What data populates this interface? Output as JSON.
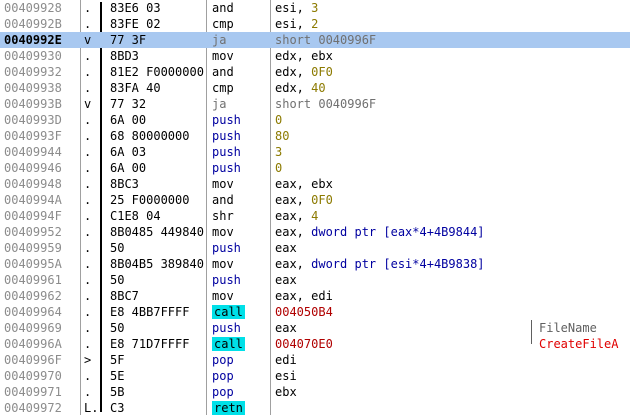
{
  "rows": [
    {
      "addr": "00409928",
      "gutter": ".",
      "hex": "83E6 03",
      "mnem": "and",
      "mstyle": "",
      "ops": [
        {
          "t": "esi, ",
          "c": "reg"
        },
        {
          "t": "3",
          "c": "num"
        }
      ],
      "comment": "",
      "cstyle": ""
    },
    {
      "addr": "0040992B",
      "gutter": ".",
      "hex": "83FE 02",
      "mnem": "cmp",
      "mstyle": "",
      "ops": [
        {
          "t": "esi, ",
          "c": "reg"
        },
        {
          "t": "2",
          "c": "num"
        }
      ],
      "comment": "",
      "cstyle": ""
    },
    {
      "addr": "0040992E",
      "gutter": "v",
      "hex": "77 3F",
      "mnem": "ja",
      "mstyle": "gray",
      "ops": [
        {
          "t": "short 0040996F",
          "c": "jmp"
        }
      ],
      "comment": "",
      "cstyle": "",
      "selected": true
    },
    {
      "addr": "00409930",
      "gutter": ".",
      "hex": "8BD3",
      "mnem": "mov",
      "mstyle": "",
      "ops": [
        {
          "t": "edx, ebx",
          "c": "reg"
        }
      ],
      "comment": "",
      "cstyle": ""
    },
    {
      "addr": "00409932",
      "gutter": ".",
      "hex": "81E2 F0000000",
      "mnem": "and",
      "mstyle": "",
      "ops": [
        {
          "t": "edx, ",
          "c": "reg"
        },
        {
          "t": "0F0",
          "c": "num"
        }
      ],
      "comment": "",
      "cstyle": ""
    },
    {
      "addr": "00409938",
      "gutter": ".",
      "hex": "83FA 40",
      "mnem": "cmp",
      "mstyle": "",
      "ops": [
        {
          "t": "edx, ",
          "c": "reg"
        },
        {
          "t": "40",
          "c": "num"
        }
      ],
      "comment": "",
      "cstyle": ""
    },
    {
      "addr": "0040993B",
      "gutter": "v",
      "hex": "77 32",
      "mnem": "ja",
      "mstyle": "gray",
      "ops": [
        {
          "t": "short 0040996F",
          "c": "jmp"
        }
      ],
      "comment": "",
      "cstyle": ""
    },
    {
      "addr": "0040993D",
      "gutter": ".",
      "hex": "6A 00",
      "mnem": "push",
      "mstyle": "blue",
      "ops": [
        {
          "t": "0",
          "c": "num"
        }
      ],
      "comment": "",
      "cstyle": ""
    },
    {
      "addr": "0040993F",
      "gutter": ".",
      "hex": "68 80000000",
      "mnem": "push",
      "mstyle": "blue",
      "ops": [
        {
          "t": "80",
          "c": "num"
        }
      ],
      "comment": "",
      "cstyle": ""
    },
    {
      "addr": "00409944",
      "gutter": ".",
      "hex": "6A 03",
      "mnem": "push",
      "mstyle": "blue",
      "ops": [
        {
          "t": "3",
          "c": "num"
        }
      ],
      "comment": "",
      "cstyle": ""
    },
    {
      "addr": "00409946",
      "gutter": ".",
      "hex": "6A 00",
      "mnem": "push",
      "mstyle": "blue",
      "ops": [
        {
          "t": "0",
          "c": "num"
        }
      ],
      "comment": "",
      "cstyle": ""
    },
    {
      "addr": "00409948",
      "gutter": ".",
      "hex": "8BC3",
      "mnem": "mov",
      "mstyle": "",
      "ops": [
        {
          "t": "eax, ebx",
          "c": "reg"
        }
      ],
      "comment": "",
      "cstyle": ""
    },
    {
      "addr": "0040994A",
      "gutter": ".",
      "hex": "25 F0000000",
      "mnem": "and",
      "mstyle": "",
      "ops": [
        {
          "t": "eax, ",
          "c": "reg"
        },
        {
          "t": "0F0",
          "c": "num"
        }
      ],
      "comment": "",
      "cstyle": ""
    },
    {
      "addr": "0040994F",
      "gutter": ".",
      "hex": "C1E8 04",
      "mnem": "shr",
      "mstyle": "",
      "ops": [
        {
          "t": "eax, ",
          "c": "reg"
        },
        {
          "t": "4",
          "c": "num"
        }
      ],
      "comment": "",
      "cstyle": ""
    },
    {
      "addr": "00409952",
      "gutter": ".",
      "hex": "8B0485 449840",
      "mnem": "mov",
      "mstyle": "",
      "ops": [
        {
          "t": "eax, ",
          "c": "reg"
        },
        {
          "t": "dword ptr [eax*4+4B9844]",
          "c": "mem"
        }
      ],
      "comment": "",
      "cstyle": ""
    },
    {
      "addr": "00409959",
      "gutter": ".",
      "hex": "50",
      "mnem": "push",
      "mstyle": "blue",
      "ops": [
        {
          "t": "eax",
          "c": "reg"
        }
      ],
      "comment": "",
      "cstyle": ""
    },
    {
      "addr": "0040995A",
      "gutter": ".",
      "hex": "8B04B5 389840",
      "mnem": "mov",
      "mstyle": "",
      "ops": [
        {
          "t": "eax, ",
          "c": "reg"
        },
        {
          "t": "dword ptr [esi*4+4B9838]",
          "c": "mem"
        }
      ],
      "comment": "",
      "cstyle": ""
    },
    {
      "addr": "00409961",
      "gutter": ".",
      "hex": "50",
      "mnem": "push",
      "mstyle": "blue",
      "ops": [
        {
          "t": "eax",
          "c": "reg"
        }
      ],
      "comment": "",
      "cstyle": ""
    },
    {
      "addr": "00409962",
      "gutter": ".",
      "hex": "8BC7",
      "mnem": "mov",
      "mstyle": "",
      "ops": [
        {
          "t": "eax, edi",
          "c": "reg"
        }
      ],
      "comment": "",
      "cstyle": ""
    },
    {
      "addr": "00409964",
      "gutter": ".",
      "hex": "E8 4BB7FFFF",
      "mnem": "call",
      "mstyle": "call",
      "ops": [
        {
          "t": "004050B4",
          "c": "addr"
        }
      ],
      "comment": "",
      "cstyle": ""
    },
    {
      "addr": "00409969",
      "gutter": ".",
      "hex": "50",
      "mnem": "push",
      "mstyle": "blue",
      "ops": [
        {
          "t": "eax",
          "c": "reg"
        }
      ],
      "comment": "FileName",
      "cstyle": "arg"
    },
    {
      "addr": "0040996A",
      "gutter": ".",
      "hex": "E8 71D7FFFF",
      "mnem": "call",
      "mstyle": "call",
      "ops": [
        {
          "t": "004070E0",
          "c": "addr"
        }
      ],
      "comment": "CreateFileA",
      "cstyle": "api"
    },
    {
      "addr": "0040996F",
      "gutter": ">",
      "hex": "5F",
      "mnem": "pop",
      "mstyle": "blue",
      "ops": [
        {
          "t": "edi",
          "c": "reg"
        }
      ],
      "comment": "",
      "cstyle": ""
    },
    {
      "addr": "00409970",
      "gutter": ".",
      "hex": "5E",
      "mnem": "pop",
      "mstyle": "blue",
      "ops": [
        {
          "t": "esi",
          "c": "reg"
        }
      ],
      "comment": "",
      "cstyle": ""
    },
    {
      "addr": "00409971",
      "gutter": ".",
      "hex": "5B",
      "mnem": "pop",
      "mstyle": "blue",
      "ops": [
        {
          "t": "ebx",
          "c": "reg"
        }
      ],
      "comment": "",
      "cstyle": ""
    },
    {
      "addr": "00409972",
      "gutter": "L.",
      "hex": "C3",
      "mnem": "retn",
      "mstyle": "call",
      "ops": [],
      "comment": "",
      "cstyle": ""
    }
  ]
}
